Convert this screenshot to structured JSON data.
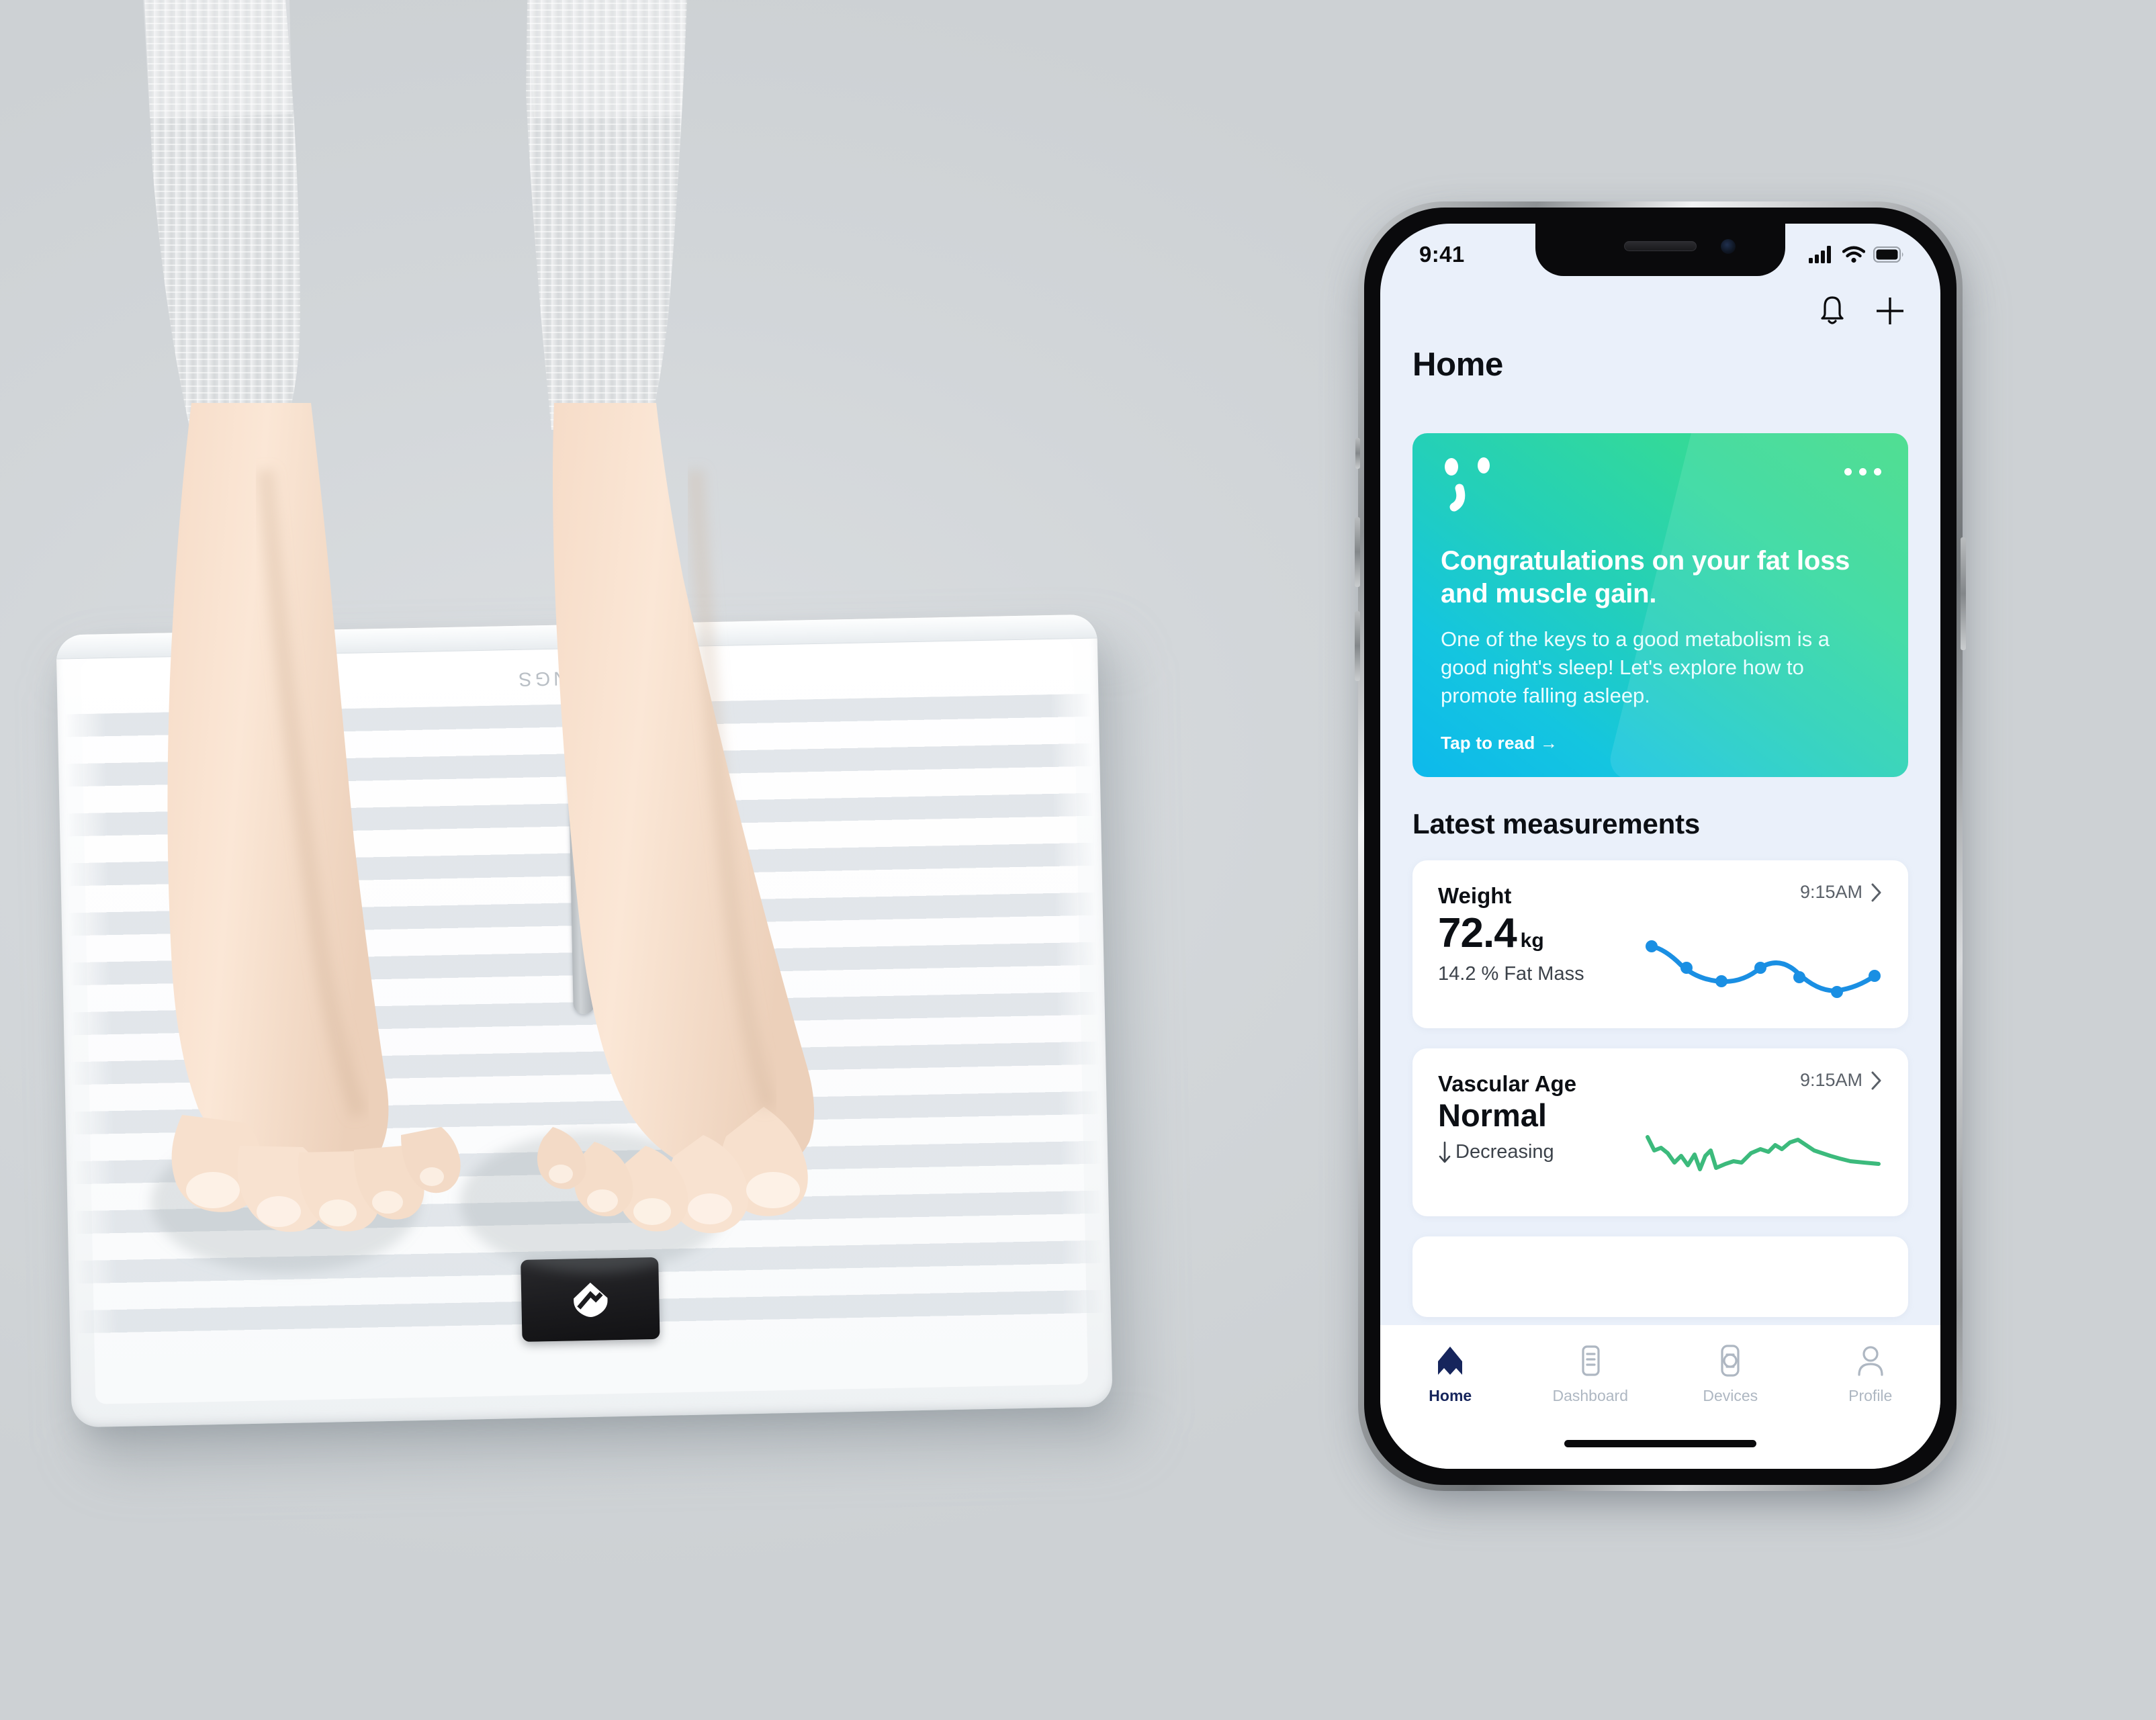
{
  "scene": {
    "background_color": "#d2d6d9",
    "device": {
      "name": "smart-scale",
      "brand_text": "WITHINGS",
      "display_logo": "withings-heart-logo"
    }
  },
  "phone": {
    "status_bar": {
      "time": "9:41",
      "cellular_icon": "signal-bars-icon",
      "wifi_icon": "wifi-icon",
      "battery_icon": "battery-full-icon"
    },
    "header": {
      "title": "Home",
      "notifications_icon": "bell-icon",
      "add_icon": "plus-icon"
    },
    "promo_card": {
      "decor_icon": "smiley-face-icon",
      "menu_icon": "more-horizontal-icon",
      "title": "Congratulations on your fat loss and muscle gain.",
      "body": "One of the keys to a good metabolism is a good night's sleep! Let's explore how to promote falling asleep.",
      "cta": "Tap to read →",
      "gradient_from": "#0db9ec",
      "gradient_to": "#3edb86"
    },
    "measurements": {
      "section_title": "Latest measurements",
      "cards": [
        {
          "label": "Weight",
          "value": "72.4",
          "unit": "kg",
          "sub": "14.2 % Fat Mass",
          "time": "9:15AM",
          "chevron_icon": "chevron-right-icon",
          "accent": "#1a8fe3"
        },
        {
          "label": "Vascular Age",
          "status": "Normal",
          "trend_icon": "arrow-down-icon",
          "trend": "Decreasing",
          "time": "9:15AM",
          "chevron_icon": "chevron-right-icon",
          "accent": "#3cba7c"
        }
      ]
    },
    "tab_bar": {
      "active_color": "#16255c",
      "inactive_color": "#aeb7c2",
      "items": [
        {
          "label": "Home",
          "icon": "home-icon",
          "active": true
        },
        {
          "label": "Dashboard",
          "icon": "dashboard-icon",
          "active": false
        },
        {
          "label": "Devices",
          "icon": "devices-icon",
          "active": false
        },
        {
          "label": "Profile",
          "icon": "profile-icon",
          "active": false
        }
      ]
    }
  },
  "chart_data": [
    {
      "type": "line",
      "title": "Weight",
      "series": [
        {
          "name": "Weight (kg)",
          "values": [
            73.4,
            72.9,
            72.5,
            72.7,
            72.55,
            72.2,
            72.4
          ]
        }
      ],
      "x": [
        1,
        2,
        3,
        4,
        5,
        6,
        7
      ],
      "ylabel": "kg",
      "xlabel": "",
      "grid": false,
      "legend": "none",
      "markers": true,
      "color": "#1a8fe3"
    },
    {
      "type": "line",
      "title": "Vascular Age",
      "series": [
        {
          "name": "Vascular Age trend",
          "values": [
            62,
            54,
            50,
            52,
            47,
            52,
            46,
            42,
            52,
            49,
            42,
            47,
            50,
            51,
            56,
            58,
            57,
            60,
            58,
            62,
            64,
            61,
            58,
            55
          ]
        }
      ],
      "ylabel": "",
      "xlabel": "",
      "grid": false,
      "legend": "none",
      "markers": false,
      "color": "#3cba7c"
    }
  ]
}
